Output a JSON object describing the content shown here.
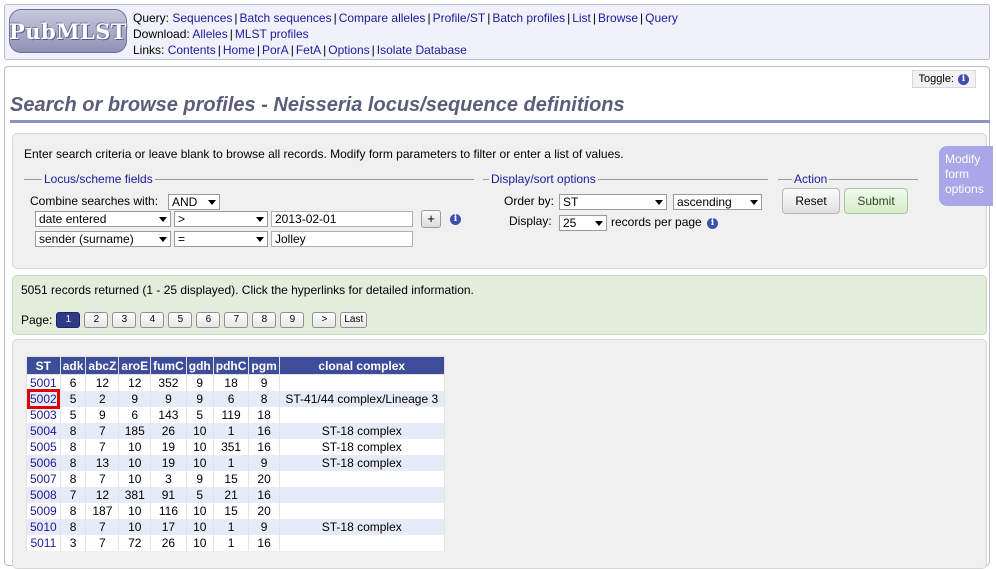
{
  "header": {
    "logo_text": "PubMLST",
    "query_label": "Query:",
    "query_links": [
      "Sequences",
      "Batch sequences",
      "Compare alleles",
      "Profile/ST",
      "Batch profiles",
      "List",
      "Browse",
      "Query"
    ],
    "download_label": "Download:",
    "download_links": [
      "Alleles",
      "MLST profiles"
    ],
    "links_label": "Links:",
    "links_links": [
      "Contents",
      "Home",
      "PorA",
      "FetA",
      "Options",
      "Isolate Database"
    ]
  },
  "toggle_label": "Toggle:",
  "page_title": "Search or browse profiles - Neisseria locus/sequence definitions",
  "form": {
    "intro": "Enter search criteria or leave blank to browse all records. Modify form parameters to filter or enter a list of values.",
    "locus_legend": "Locus/scheme fields",
    "combine_label": "Combine searches with:",
    "combine_value": "AND",
    "row1": {
      "field": "date entered",
      "operator": ">",
      "value": "2013-02-01"
    },
    "row2": {
      "field": "sender (surname)",
      "operator": "=",
      "value": "Jolley"
    },
    "add_button": "+",
    "display_legend": "Display/sort options",
    "order_label": "Order by:",
    "order_value": "ST",
    "direction_value": "ascending",
    "display_label": "Display:",
    "display_value": "25",
    "records_per_page": "records per page",
    "action_legend": "Action",
    "reset": "Reset",
    "submit": "Submit"
  },
  "modify_tab": "Modify form options",
  "results": {
    "count_text": "5051 records returned (1 - 25 displayed). Click the hyperlinks for detailed information.",
    "page_label": "Page:",
    "pages": [
      "1",
      "2",
      "3",
      "4",
      "5",
      "6",
      "7",
      "8",
      "9"
    ],
    "next": ">",
    "last": "Last"
  },
  "table": {
    "columns": [
      "ST",
      "adk",
      "abcZ",
      "aroE",
      "fumC",
      "gdh",
      "pdhC",
      "pgm",
      "clonal complex"
    ],
    "rows": [
      [
        "5001",
        "6",
        "12",
        "12",
        "352",
        "9",
        "18",
        "9",
        ""
      ],
      [
        "5002",
        "5",
        "2",
        "9",
        "9",
        "9",
        "6",
        "8",
        "ST-41/44 complex/Lineage 3"
      ],
      [
        "5003",
        "5",
        "9",
        "6",
        "143",
        "5",
        "119",
        "18",
        ""
      ],
      [
        "5004",
        "8",
        "7",
        "185",
        "26",
        "10",
        "1",
        "16",
        "ST-18 complex"
      ],
      [
        "5005",
        "8",
        "7",
        "10",
        "19",
        "10",
        "351",
        "16",
        "ST-18 complex"
      ],
      [
        "5006",
        "8",
        "13",
        "10",
        "19",
        "10",
        "1",
        "9",
        "ST-18 complex"
      ],
      [
        "5007",
        "8",
        "7",
        "10",
        "3",
        "9",
        "15",
        "20",
        ""
      ],
      [
        "5008",
        "7",
        "12",
        "381",
        "91",
        "5",
        "21",
        "16",
        ""
      ],
      [
        "5009",
        "8",
        "187",
        "10",
        "116",
        "10",
        "15",
        "20",
        ""
      ],
      [
        "5010",
        "8",
        "7",
        "10",
        "17",
        "10",
        "1",
        "9",
        "ST-18 complex"
      ],
      [
        "5011",
        "3",
        "7",
        "72",
        "26",
        "10",
        "1",
        "16",
        ""
      ]
    ]
  },
  "colors": {
    "accent": "#3d4d9a",
    "title": "#5a5e78",
    "link": "#1b1b9a",
    "highlight": "#e00000"
  }
}
